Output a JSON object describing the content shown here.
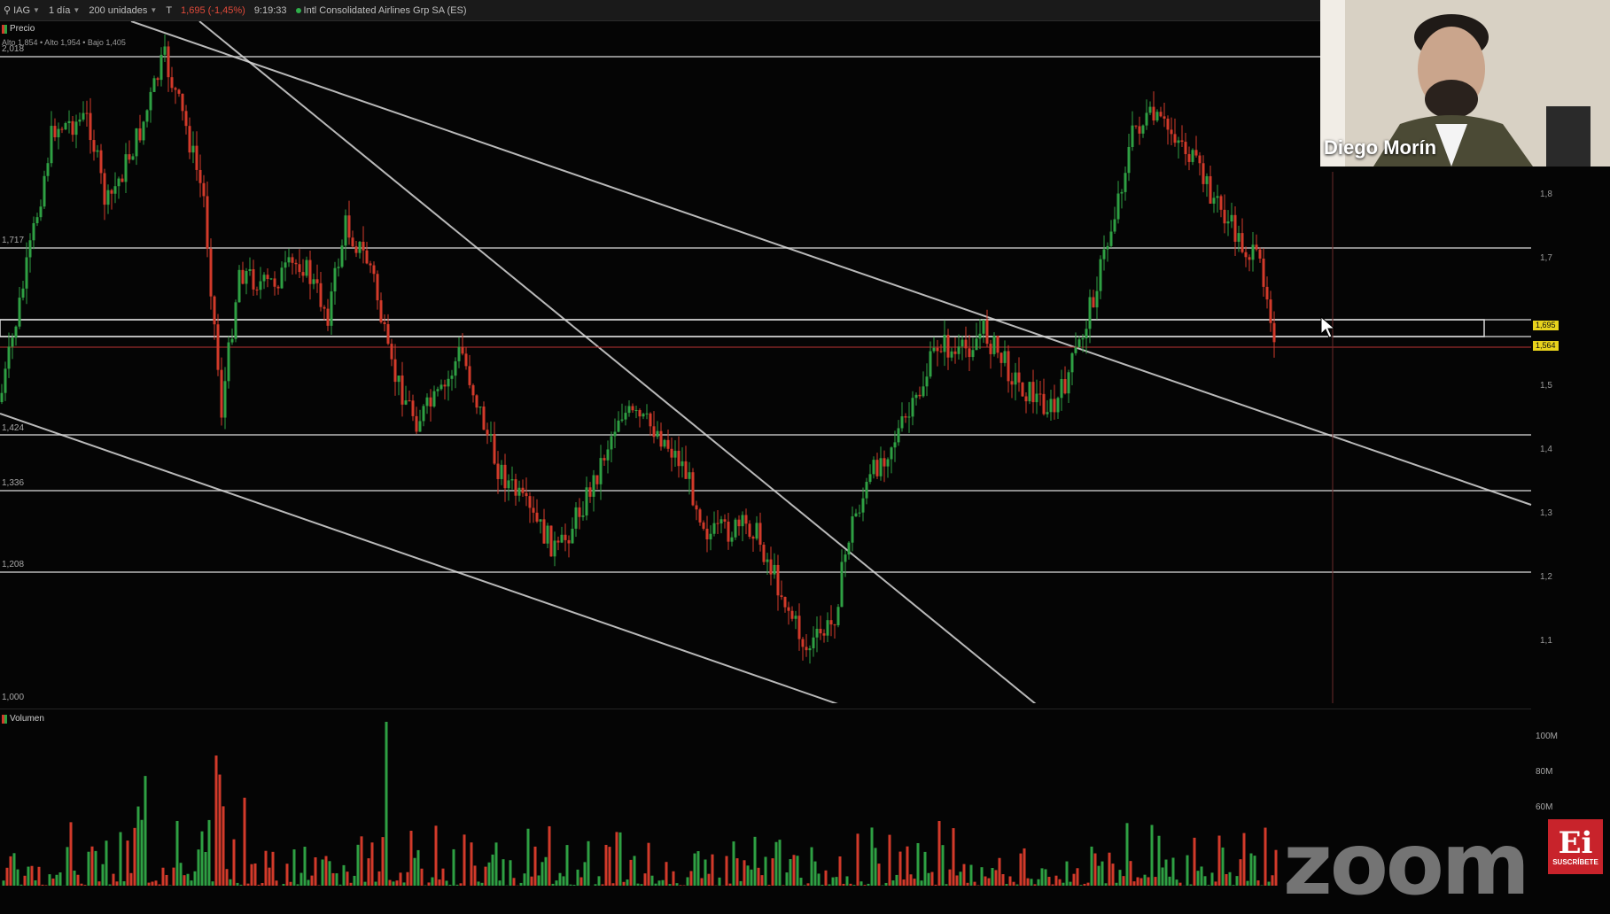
{
  "toolbar": {
    "symbol": "IAG",
    "timeframe": "1 día",
    "units": "200 unidades",
    "price_change": "1,695 (-1,45%)",
    "time": "9:19:33",
    "instrument": "Intl Consolidated Airlines Grp SA (ES)"
  },
  "price_panel": {
    "label": "Precio",
    "range": "Alto 1,854 • Alto 1,954 • Bajo 1,405",
    "levels": [
      "2,018",
      "1,717",
      "1,424",
      "1,336",
      "1,208",
      "1,000"
    ]
  },
  "axis": {
    "ticks": [
      "1,8",
      "1,7",
      "1,5",
      "1,4",
      "1,3",
      "1,2",
      "1,1"
    ],
    "current_badge": "1,695",
    "second_badge": "1,564"
  },
  "volume_panel": {
    "label": "Volumen",
    "ticks": [
      "100M",
      "80M",
      "60M"
    ]
  },
  "webcam": {
    "name": "Diego Morín"
  },
  "watermark": "zoom",
  "logo": {
    "mark": "Ei",
    "caption": "SUSCRÍBETE"
  },
  "colors": {
    "up": "#2ea043",
    "down": "#d23a2a",
    "line": "#d9d9d9",
    "badge": "#e8d21c"
  }
}
